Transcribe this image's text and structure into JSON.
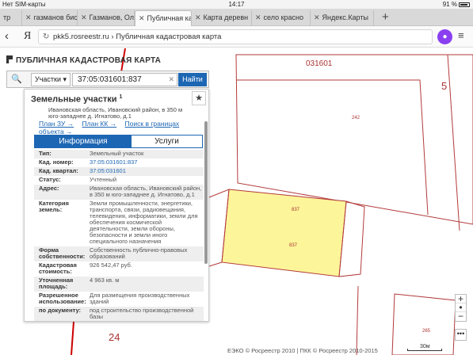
{
  "statusbar": {
    "carrier": "Нет SIM-карты",
    "time": "14:17",
    "battery": "91 %"
  },
  "tabs": [
    {
      "label": "тр"
    },
    {
      "label": "газманов бис"
    },
    {
      "label": "Газманов, Оле"
    },
    {
      "label": "Публичная кад"
    },
    {
      "label": "Карта деревн"
    },
    {
      "label": "село красно"
    },
    {
      "label": "Яндекс.Карты"
    }
  ],
  "addressbar": {
    "url": "pkk5.rosreestr.ru",
    "separator": " › ",
    "page_title": "Публичная кадастровая карта"
  },
  "app": {
    "title": "ПУБЛИЧНАЯ КАДАСТРОВАЯ КАРТА"
  },
  "search": {
    "type_value": "Участки",
    "query": "37:05:031601:837",
    "button": "Найти"
  },
  "panel": {
    "title": "Земельные участки",
    "title_sup": "1",
    "top_address": "Ивановская область, Ивановский район, в 350 м юго-западнее д. Игнатово, д.1",
    "links": [
      "План ЗУ →",
      "План КК →",
      "Поиск в границах объекта →"
    ],
    "tab_info": "Информация",
    "tab_services": "Услуги",
    "rows": [
      {
        "k": "Тип:",
        "v": "Земельный участок"
      },
      {
        "k": "Кад. номер:",
        "v": "37:05:031601:837"
      },
      {
        "k": "Кад. квартал:",
        "v": "37:05:031601"
      },
      {
        "k": "Статус:",
        "v": "Учтенный"
      },
      {
        "k": "Адрес:",
        "v": "Ивановская область, Ивановский район, в 350 м юго-западнее д. Игнатово, д.1"
      },
      {
        "k": "Категория земель:",
        "v": "Земли промышленности, энергетики, транспорта, связи, радиовещания, телевидения, информатики, земли для обеспечения космической деятельности, земли обороны, безопасности и земли иного специального назначения"
      },
      {
        "k": "Форма собственности:",
        "v": "Собственность публично-правовых образований"
      },
      {
        "k": "Кадастровая стоимость:",
        "v": "926 542,47 руб."
      },
      {
        "k": "Уточненная площадь:",
        "v": "4 963 кв. м"
      },
      {
        "k": "Разрешенное использование:",
        "v": "Для размещения производственных зданий"
      },
      {
        "k": "по документу:",
        "v": "под строительство производственной базы"
      }
    ]
  },
  "map": {
    "labels": {
      "block": "031601",
      "num5": "5",
      "num24": "24",
      "p242": "242",
      "p837a": "837",
      "p837b": "837",
      "p265": "265"
    },
    "copyright": "ЕЭКО © Росреестр 2010 | ПКК © Росреестр 2010-2015",
    "scale": "30м",
    "colors": {
      "parcel_border": "#b33a3a",
      "selected_fill": "#fdf59a"
    }
  },
  "zoom": {
    "plus": "+",
    "minus": "−",
    "more": "•••"
  }
}
